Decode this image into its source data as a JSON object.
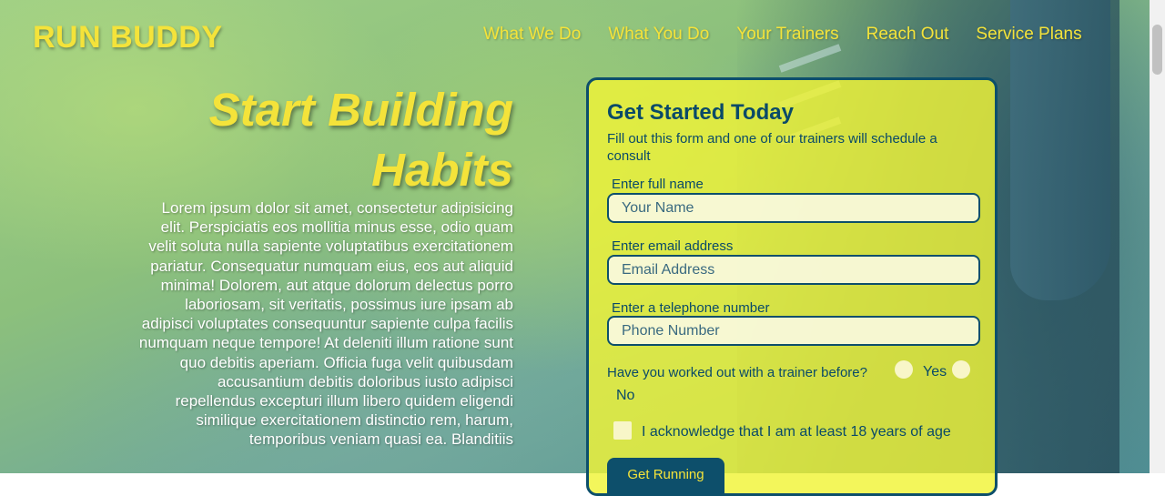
{
  "brand": {
    "logo": "RUN BUDDY"
  },
  "nav": {
    "items": [
      "What We Do",
      "What You Do",
      "Your Trainers",
      "Reach Out",
      "Service Plans"
    ]
  },
  "hero": {
    "title_line1": "Start Building",
    "title_line2": "Habits",
    "body": "Lorem ipsum dolor sit amet, consectetur adipisicing elit. Perspiciatis eos mollitia minus esse, odio quam velit soluta nulla sapiente voluptatibus exercitationem pariatur. Consequatur numquam eius, eos aut aliquid minima! Dolorem, aut atque dolorum delectus porro laboriosam, sit veritatis, possimus iure ipsam ab adipisci voluptates consequuntur sapiente culpa facilis numquam neque tempore! At deleniti illum ratione sunt quo debitis aperiam. Officia fuga velit quibusdam accusantium debitis doloribus iusto adipisci repellendus excepturi illum libero quidem eligendi similique exercitationem distinctio rem, harum, temporibus veniam quasi ea. Blanditiis"
  },
  "form": {
    "title": "Get Started Today",
    "subtitle": "Fill out this form and one of our trainers will schedule a consult",
    "name_label": "Enter full name",
    "name_placeholder": "Your Name",
    "email_label": "Enter email address",
    "email_placeholder": "Email Address",
    "phone_label": "Enter a telephone number",
    "phone_placeholder": "Phone Number",
    "trainer_question": "Have you worked out with a trainer before?",
    "yes_label": "Yes",
    "no_label": "No",
    "age_ack": "I acknowledge that I am at least 18 years of age",
    "submit_label": "Get Running"
  },
  "colors": {
    "accent_yellow": "#f4e33a",
    "brand_navy": "#0d4f6b",
    "form_bg": "#f0f437"
  }
}
